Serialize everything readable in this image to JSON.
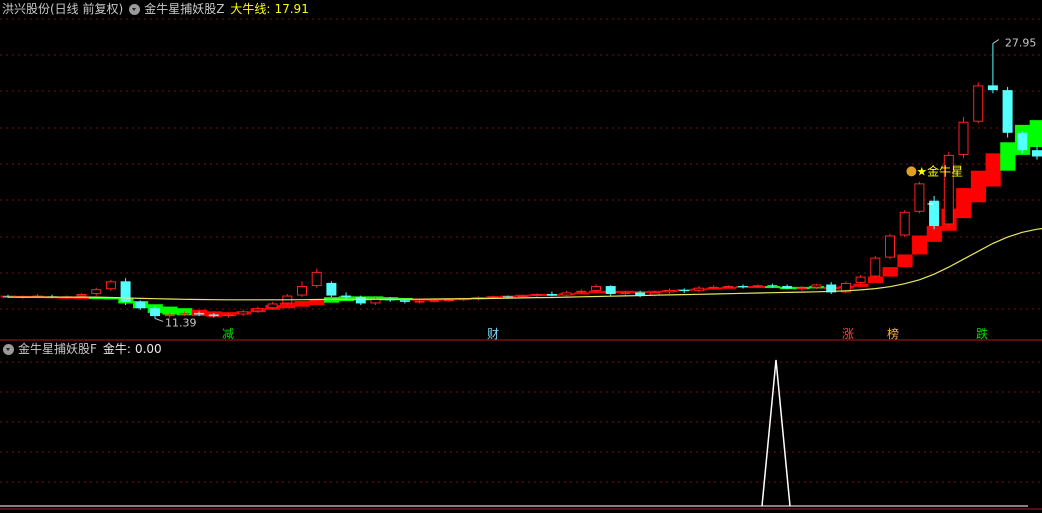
{
  "header": {
    "stock_name": "洪兴股份(日线 前复权)",
    "indicator_name": "金牛星捕妖股Z",
    "indicator_line_label": "大牛线:",
    "indicator_line_value": "17.91"
  },
  "sub_header": {
    "indicator_name": "金牛星捕妖股F",
    "value_label": "金牛:",
    "value": "0.00"
  },
  "annotations": {
    "high_price": "27.95",
    "low_price": "11.39",
    "signal_label": "金牛星",
    "event_tags": [
      {
        "text": "减",
        "color": "#00e000"
      },
      {
        "text": "财",
        "color": "#7fd8ff"
      },
      {
        "text": "涨",
        "color": "#ff4040"
      },
      {
        "text": "榜",
        "color": "#ffb040"
      },
      {
        "text": "跌",
        "color": "#00e000"
      }
    ]
  },
  "colors": {
    "up": "#ff2020",
    "down": "#54ffff",
    "ribbon_bull": "#ff0000",
    "ribbon_bear": "#00ff00",
    "bull_line": "#e8e860",
    "grid": "#7a1010",
    "divider": "#b01818",
    "signal_line": "#ffffff"
  },
  "chart_data": [
    {
      "type": "candlestick",
      "title": "洪兴股份(日线 前复权)",
      "ylim": [
        10.2,
        29.5
      ],
      "series": [
        {
          "name": "K",
          "candles": [
            [
              11.95,
              12.05,
              11.85,
              11.9
            ],
            [
              11.9,
              12.0,
              11.8,
              11.95
            ],
            [
              11.95,
              12.1,
              11.9,
              12.0
            ],
            [
              11.95,
              12.05,
              11.85,
              11.9
            ],
            [
              11.9,
              12.0,
              11.8,
              11.95
            ],
            [
              11.95,
              12.15,
              11.9,
              12.1
            ],
            [
              12.1,
              12.5,
              12.0,
              12.4
            ],
            [
              12.4,
              13.0,
              12.3,
              12.9
            ],
            [
              12.9,
              13.1,
              11.4,
              11.6
            ],
            [
              11.6,
              11.7,
              11.1,
              11.2
            ],
            [
              11.2,
              11.3,
              10.55,
              10.7
            ],
            [
              10.7,
              10.9,
              10.6,
              10.8
            ],
            [
              10.8,
              11.0,
              10.7,
              10.9
            ],
            [
              10.9,
              11.0,
              10.7,
              10.8
            ],
            [
              10.8,
              10.9,
              10.6,
              10.7
            ],
            [
              10.7,
              10.9,
              10.6,
              10.8
            ],
            [
              10.8,
              11.1,
              10.7,
              11.0
            ],
            [
              11.0,
              11.3,
              10.9,
              11.2
            ],
            [
              11.2,
              11.6,
              11.1,
              11.5
            ],
            [
              11.5,
              12.1,
              11.4,
              12.0
            ],
            [
              12.0,
              12.9,
              11.9,
              12.6
            ],
            [
              12.6,
              13.7,
              12.5,
              13.5
            ],
            [
              12.8,
              12.9,
              11.9,
              12.0
            ],
            [
              12.0,
              12.2,
              11.8,
              11.9
            ],
            [
              11.9,
              12.0,
              11.4,
              11.5
            ],
            [
              11.5,
              11.9,
              11.4,
              11.8
            ],
            [
              11.8,
              11.9,
              11.6,
              11.7
            ],
            [
              11.7,
              11.8,
              11.5,
              11.6
            ],
            [
              11.6,
              11.7,
              11.5,
              11.65
            ],
            [
              11.65,
              11.75,
              11.55,
              11.7
            ],
            [
              11.7,
              11.8,
              11.6,
              11.75
            ],
            [
              11.75,
              11.85,
              11.65,
              11.8
            ],
            [
              11.8,
              11.95,
              11.7,
              11.9
            ],
            [
              11.9,
              12.0,
              11.8,
              11.95
            ],
            [
              11.95,
              12.0,
              11.8,
              11.9
            ],
            [
              11.9,
              12.05,
              11.85,
              12.0
            ],
            [
              12.0,
              12.15,
              11.9,
              12.1
            ],
            [
              12.1,
              12.25,
              11.95,
              12.0
            ],
            [
              12.0,
              12.3,
              11.95,
              12.2
            ],
            [
              12.2,
              12.4,
              12.1,
              12.3
            ],
            [
              12.3,
              12.7,
              12.2,
              12.6
            ],
            [
              12.6,
              12.65,
              12.0,
              12.1
            ],
            [
              12.1,
              12.3,
              12.0,
              12.2
            ],
            [
              12.2,
              12.3,
              11.9,
              12.0
            ],
            [
              12.0,
              12.3,
              11.95,
              12.2
            ],
            [
              12.2,
              12.45,
              12.1,
              12.35
            ],
            [
              12.35,
              12.45,
              12.15,
              12.3
            ],
            [
              12.3,
              12.6,
              12.2,
              12.5
            ],
            [
              12.5,
              12.65,
              12.4,
              12.55
            ],
            [
              12.55,
              12.65,
              12.45,
              12.6
            ],
            [
              12.6,
              12.7,
              12.45,
              12.55
            ],
            [
              12.55,
              12.7,
              12.5,
              12.65
            ],
            [
              12.65,
              12.75,
              12.5,
              12.6
            ],
            [
              12.6,
              12.7,
              12.4,
              12.45
            ],
            [
              12.45,
              12.6,
              12.3,
              12.5
            ],
            [
              12.5,
              12.75,
              12.4,
              12.7
            ],
            [
              12.7,
              12.85,
              12.1,
              12.2
            ],
            [
              12.2,
              12.9,
              12.15,
              12.8
            ],
            [
              12.8,
              13.3,
              12.7,
              13.2
            ],
            [
              13.2,
              14.5,
              13.1,
              14.4
            ],
            [
              14.4,
              15.9,
              14.3,
              15.8
            ],
            [
              15.8,
              17.4,
              15.7,
              17.3
            ],
            [
              17.3,
              19.2,
              17.2,
              19.1
            ],
            [
              18.0,
              18.3,
              16.2,
              16.4
            ],
            [
              16.5,
              21.1,
              16.3,
              20.9
            ],
            [
              20.9,
              23.3,
              20.7,
              23.0
            ],
            [
              23.0,
              25.5,
              22.9,
              25.3
            ],
            [
              25.3,
              27.95,
              24.8,
              25.0
            ],
            [
              25.0,
              25.2,
              22.0,
              22.3
            ],
            [
              22.3,
              22.4,
              21.0,
              21.2
            ],
            [
              21.2,
              21.5,
              20.6,
              20.8
            ],
            [
              20.8,
              21.5,
              20.7,
              21.3
            ],
            [
              21.3,
              21.4,
              20.6,
              20.8
            ],
            [
              20.8,
              21.3,
              20.7,
              21.2
            ],
            [
              21.2,
              22.7,
              21.1,
              22.5
            ],
            [
              22.5,
              22.8,
              21.6,
              21.8
            ],
            [
              21.8,
              22.5,
              21.7,
              22.3
            ],
            [
              22.3,
              22.4,
              19.9,
              20.2
            ],
            [
              20.2,
              21.0,
              19.8,
              20.9
            ],
            [
              20.9,
              21.8,
              20.8,
              21.7
            ],
            [
              21.7,
              23.1,
              21.6,
              22.5
            ]
          ],
          "ribbon": [
            [
              11.95,
              12.0
            ],
            [
              11.92,
              11.98
            ],
            [
              11.9,
              11.98
            ],
            [
              11.88,
              11.95
            ],
            [
              11.85,
              11.92
            ],
            [
              11.8,
              11.9
            ],
            [
              11.82,
              11.9
            ],
            [
              11.8,
              11.88
            ],
            [
              11.5,
              11.85
            ],
            [
              11.2,
              11.65
            ],
            [
              10.9,
              11.45
            ],
            [
              10.8,
              11.3
            ],
            [
              10.75,
              11.2
            ],
            [
              10.7,
              11.1
            ],
            [
              10.65,
              11.0
            ],
            [
              10.7,
              10.95
            ],
            [
              10.8,
              11.0
            ],
            [
              10.95,
              11.2
            ],
            [
              11.1,
              11.4
            ],
            [
              11.2,
              11.55
            ],
            [
              11.3,
              11.65
            ],
            [
              11.4,
              11.75
            ],
            [
              11.55,
              11.9
            ],
            [
              11.65,
              11.95
            ],
            [
              11.7,
              11.95
            ],
            [
              11.7,
              11.95
            ],
            [
              11.7,
              11.9
            ],
            [
              11.7,
              11.85
            ],
            [
              11.7,
              11.8
            ],
            [
              11.7,
              11.8
            ],
            [
              11.72,
              11.82
            ],
            [
              11.75,
              11.85
            ],
            [
              11.8,
              11.9
            ],
            [
              11.85,
              11.95
            ],
            [
              11.9,
              12.0
            ],
            [
              11.95,
              12.05
            ],
            [
              12.0,
              12.1
            ],
            [
              12.0,
              12.1
            ],
            [
              12.05,
              12.15
            ],
            [
              12.1,
              12.2
            ],
            [
              12.15,
              12.3
            ],
            [
              12.15,
              12.3
            ],
            [
              12.15,
              12.3
            ],
            [
              12.15,
              12.28
            ],
            [
              12.2,
              12.3
            ],
            [
              12.25,
              12.35
            ],
            [
              12.3,
              12.4
            ],
            [
              12.35,
              12.45
            ],
            [
              12.4,
              12.5
            ],
            [
              12.45,
              12.55
            ],
            [
              12.5,
              12.6
            ],
            [
              12.5,
              12.6
            ],
            [
              12.5,
              12.6
            ],
            [
              12.4,
              12.55
            ],
            [
              12.4,
              12.55
            ],
            [
              12.45,
              12.6
            ],
            [
              12.4,
              12.55
            ],
            [
              12.45,
              12.6
            ],
            [
              12.55,
              12.75
            ],
            [
              12.8,
              13.2
            ],
            [
              13.2,
              13.8
            ],
            [
              13.8,
              14.6
            ],
            [
              14.6,
              15.8
            ],
            [
              15.4,
              16.4
            ],
            [
              16.1,
              17.5
            ],
            [
              16.9,
              18.8
            ],
            [
              17.9,
              19.9
            ],
            [
              18.9,
              21.0
            ],
            [
              19.9,
              21.7
            ],
            [
              20.9,
              22.8
            ],
            [
              21.4,
              23.1
            ],
            [
              21.4,
              23.0
            ],
            [
              21.6,
              22.9
            ],
            [
              21.6,
              22.6
            ],
            [
              21.7,
              22.5
            ],
            [
              21.5,
              22.5
            ],
            [
              21.2,
              22.3
            ],
            [
              20.6,
              22.2
            ],
            [
              20.4,
              21.6
            ],
            [
              20.5,
              21.1
            ],
            [
              20.4,
              20.9
            ]
          ],
          "ribbon_bear_indices": [
            6,
            7,
            8,
            9,
            10,
            11,
            12,
            22,
            23,
            24,
            25,
            26,
            27,
            52,
            53,
            54,
            55,
            68,
            69,
            70,
            71,
            72,
            73,
            74,
            75,
            76,
            77,
            78,
            79
          ]
        },
        {
          "name": "大牛线",
          "values": [
            11.9,
            11.9,
            11.9,
            11.9,
            11.9,
            11.9,
            11.9,
            11.88,
            11.85,
            11.82,
            11.8,
            11.78,
            11.76,
            11.75,
            11.74,
            11.73,
            11.73,
            11.73,
            11.73,
            11.73,
            11.74,
            11.75,
            11.76,
            11.76,
            11.76,
            11.76,
            11.76,
            11.77,
            11.77,
            11.78,
            11.79,
            11.8,
            11.81,
            11.82,
            11.83,
            11.85,
            11.87,
            11.88,
            11.9,
            11.92,
            11.94,
            11.96,
            11.98,
            12.0,
            12.02,
            12.04,
            12.06,
            12.08,
            12.1,
            12.12,
            12.14,
            12.16,
            12.18,
            12.2,
            12.22,
            12.24,
            12.26,
            12.3,
            12.36,
            12.44,
            12.56,
            12.75,
            13.0,
            13.35,
            13.8,
            14.3,
            14.8,
            15.3,
            15.7,
            16.0,
            16.2,
            16.3,
            16.4,
            16.5,
            16.6,
            16.75,
            16.9,
            17.05,
            17.2,
            17.35,
            17.5
          ]
        }
      ]
    },
    {
      "type": "line",
      "title": "金牛星捕妖股F",
      "ylim": [
        0,
        1
      ],
      "series": [
        {
          "name": "金牛",
          "signal_index": 62,
          "values_note_hidden": ""
        }
      ]
    }
  ]
}
